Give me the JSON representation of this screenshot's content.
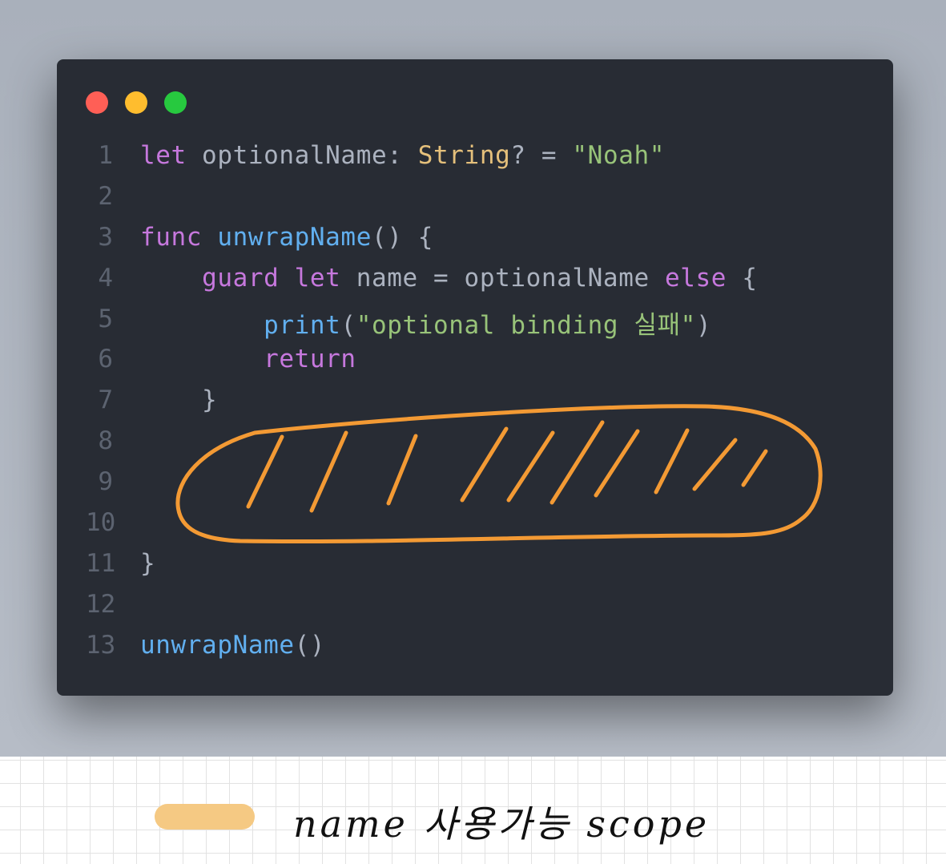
{
  "window_controls": [
    "close",
    "minimize",
    "zoom"
  ],
  "code_lines": [
    {
      "n": "1",
      "tokens": [
        {
          "t": "let",
          "c": "kw"
        },
        {
          "t": " optionalName: ",
          "c": "pl"
        },
        {
          "t": "String",
          "c": "ty"
        },
        {
          "t": "? = ",
          "c": "pl"
        },
        {
          "t": "\"Noah\"",
          "c": "st"
        }
      ]
    },
    {
      "n": "2",
      "tokens": []
    },
    {
      "n": "3",
      "tokens": [
        {
          "t": "func",
          "c": "kw"
        },
        {
          "t": " ",
          "c": "pl"
        },
        {
          "t": "unwrapName",
          "c": "fn"
        },
        {
          "t": "() {",
          "c": "pl"
        }
      ]
    },
    {
      "n": "4",
      "tokens": [
        {
          "t": "    ",
          "c": "pl"
        },
        {
          "t": "guard",
          "c": "kw"
        },
        {
          "t": " ",
          "c": "pl"
        },
        {
          "t": "let",
          "c": "kw"
        },
        {
          "t": " name = optionalName ",
          "c": "pl"
        },
        {
          "t": "else",
          "c": "kw"
        },
        {
          "t": " {",
          "c": "pl"
        }
      ]
    },
    {
      "n": "5",
      "tokens": [
        {
          "t": "        ",
          "c": "pl"
        },
        {
          "t": "print",
          "c": "fn"
        },
        {
          "t": "(",
          "c": "pl"
        },
        {
          "t": "\"optional binding 실패\"",
          "c": "st"
        },
        {
          "t": ")",
          "c": "pl"
        }
      ]
    },
    {
      "n": "6",
      "tokens": [
        {
          "t": "        ",
          "c": "pl"
        },
        {
          "t": "return",
          "c": "kw"
        }
      ]
    },
    {
      "n": "7",
      "tokens": [
        {
          "t": "    }",
          "c": "pl"
        }
      ]
    },
    {
      "n": "8",
      "tokens": []
    },
    {
      "n": "9",
      "tokens": []
    },
    {
      "n": "10",
      "tokens": []
    },
    {
      "n": "11",
      "tokens": [
        {
          "t": "}",
          "c": "pl"
        }
      ]
    },
    {
      "n": "12",
      "tokens": []
    },
    {
      "n": "13",
      "tokens": [
        {
          "t": "unwrapName",
          "c": "fn"
        },
        {
          "t": "()",
          "c": "pl"
        }
      ]
    }
  ],
  "legend": {
    "label": "name 사용가능 scope",
    "swatch_color": "#f5c983"
  },
  "colors": {
    "keyword": "#c678dd",
    "type": "#e5c07b",
    "string": "#98c379",
    "function": "#61afef",
    "plain": "#abb2bf",
    "line_number": "#5c6370",
    "annotation": "#f39a34"
  }
}
